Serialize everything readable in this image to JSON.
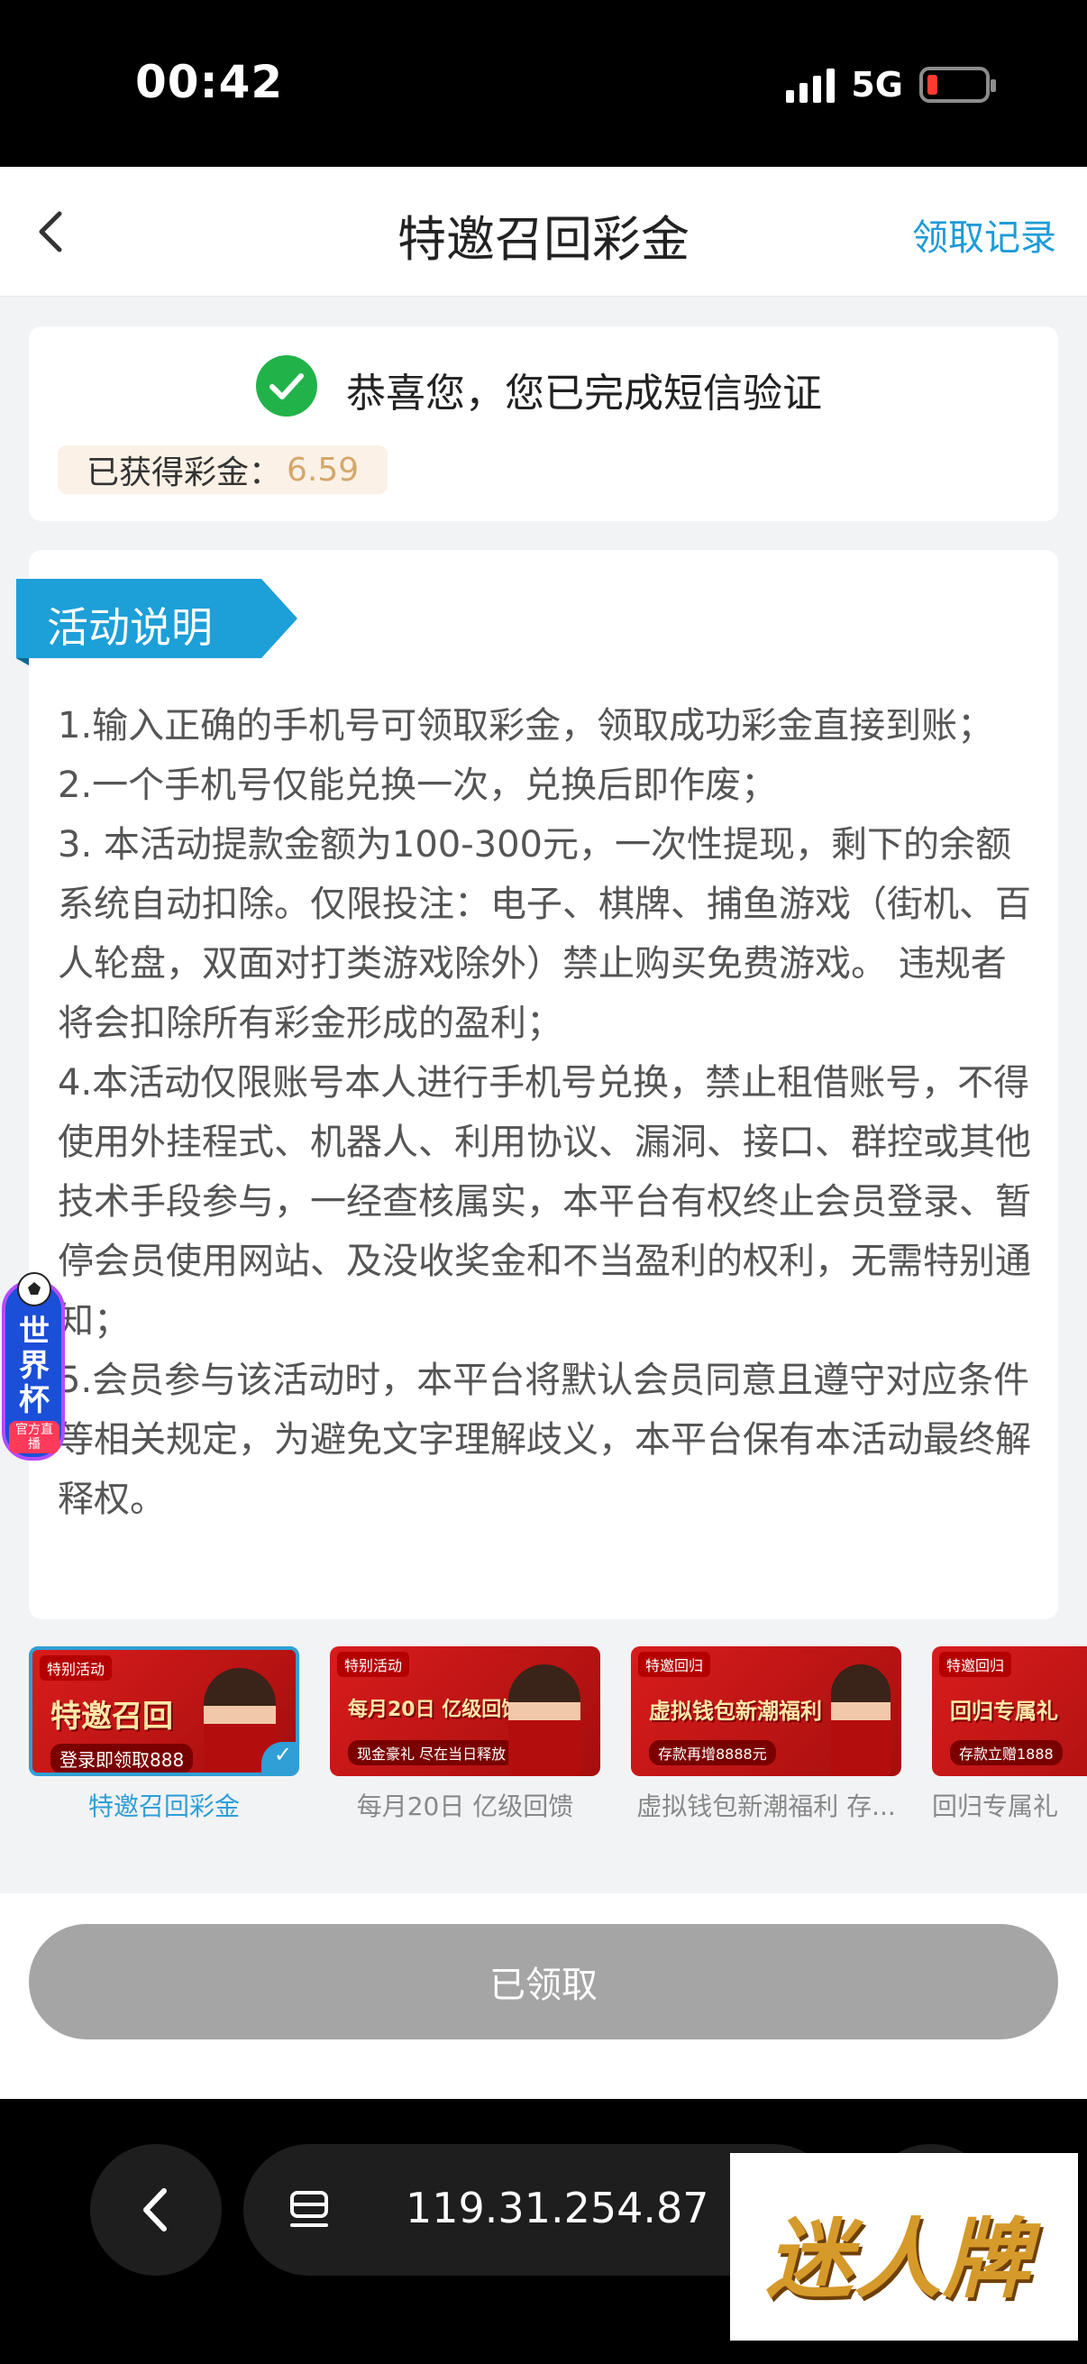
{
  "status_bar": {
    "time": "00:42",
    "network": "5G"
  },
  "header": {
    "title": "特邀召回彩金",
    "record_link": "领取记录"
  },
  "verification": {
    "message": "恭喜您，您已完成短信验证",
    "bonus_label": "已获得彩金：",
    "bonus_value": "6.59"
  },
  "description": {
    "section_title": "活动说明",
    "paragraphs": [
      "1.输入正确的手机号可领取彩金，领取成功彩金直接到账；",
      "2.一个手机号仅能兑换一次，兑换后即作废；",
      "3. 本活动提款金额为100-300元，一次性提现，剩下的余额系统自动扣除。仅限投注：电子、棋牌、捕鱼游戏（街机、百人轮盘，双面对打类游戏除外）禁止购买免费游戏。 违规者将会扣除所有彩金形成的盈利；",
      "4.本活动仅限账号本人进行手机号兑换，禁止租借账号，不得使用外挂程式、机器人、利用协议、漏洞、接口、群控或其他技术手段参与，一经查核属实，本平台有权终止会员登录、暂停会员使用网站、及没收奖金和不当盈利的权利，无需特别通知；",
      "5.会员参与该活动时，本平台将默认会员同意且遵守对应条件等相关规定，为避免文字理解歧义，本平台保有本活动最终解释权。"
    ]
  },
  "world_cup_badge": {
    "label": "世界杯",
    "sub": "官方直播"
  },
  "promotions": [
    {
      "tag": "特别活动",
      "headline": "特邀召回",
      "sub": "登录即领取888",
      "caption": "特邀召回彩金",
      "active": true
    },
    {
      "tag": "特别活动",
      "headline": "每月20日 亿级回馈",
      "sub": "现金豪礼 尽在当日释放",
      "caption": "每月20日 亿级回馈",
      "active": false
    },
    {
      "tag": "特邀回归",
      "headline": "虚拟钱包新潮福利",
      "sub": "存款再增8888元",
      "caption": "虚拟钱包新潮福利 存...",
      "active": false
    },
    {
      "tag": "特邀回归",
      "headline": "回归专属礼",
      "sub": "存款立赠1888",
      "caption": "回归专属礼",
      "active": false
    }
  ],
  "claim_button": {
    "label": "已领取"
  },
  "browser": {
    "url": "119.31.254.87"
  },
  "watermark": {
    "text": "迷人牌"
  },
  "colors": {
    "accent": "#1e9bd7",
    "success": "#21b34a",
    "bonus": "#d4a76a",
    "button_disabled": "#a5a5a5"
  }
}
